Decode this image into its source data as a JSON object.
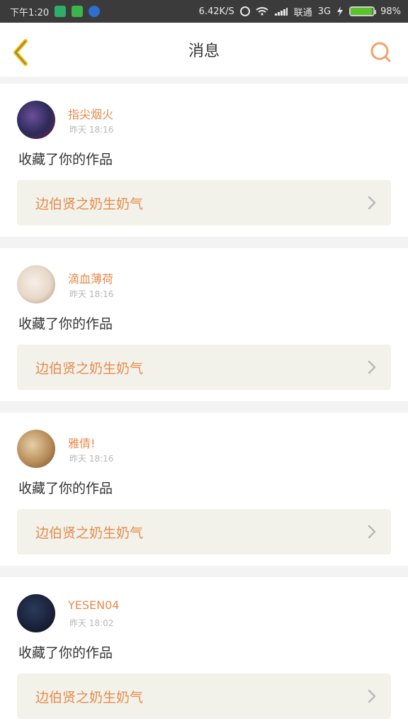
{
  "status_bar": {
    "time": "下午1:20",
    "speed": "6.42K/S",
    "carrier": "联通",
    "network": "3G",
    "battery": "98%",
    "battery_level": 0.98
  },
  "header": {
    "title": "消息"
  },
  "messages": [
    {
      "user": "指尖烟火",
      "time": "昨天 18:16",
      "text": "收藏了你的作品",
      "work": "边伯贤之奶生奶气"
    },
    {
      "user": "滴血薄荷",
      "time": "昨天 18:16",
      "text": "收藏了你的作品",
      "work": "边伯贤之奶生奶气"
    },
    {
      "user": "雅倩!",
      "time": "昨天 18:16",
      "text": "收藏了你的作品",
      "work": "边伯贤之奶生奶气"
    },
    {
      "user": "YESEN04",
      "time": "昨天 18:02",
      "text": "收藏了你的作品",
      "work": "边伯贤之奶生奶气"
    }
  ],
  "colors": {
    "accent": "#e58b4d",
    "back_icon_stroke": "#f0c21b",
    "search_icon_stroke": "#f2a16a"
  }
}
